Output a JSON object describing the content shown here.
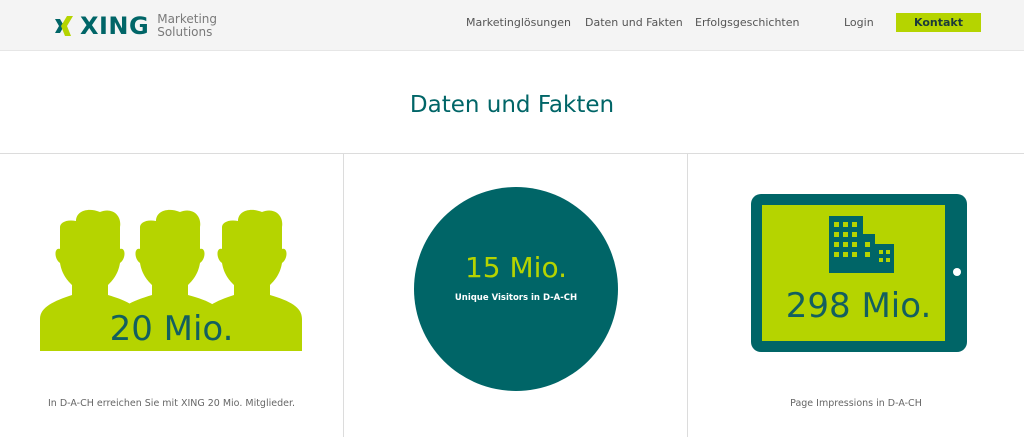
{
  "brand": {
    "name": "XING",
    "sub_line1": "Marketing",
    "sub_line2": "Solutions"
  },
  "nav": [
    {
      "label": "Marketinglösungen"
    },
    {
      "label": "Daten und Fakten"
    },
    {
      "label": "Erfolgsgeschichten"
    }
  ],
  "login_label": "Login",
  "contact_label": "Kontakt",
  "page_title": "Daten und Fakten",
  "facts": [
    {
      "value": "20 Mio.",
      "caption": "In D-A-CH erreichen Sie mit XING 20 Mio. Mitglieder."
    },
    {
      "value": "15 Mio.",
      "caption": "Unique Visitors in D-A-CH"
    },
    {
      "value": "298 Mio.",
      "caption": "Page Impressions in D-A-CH"
    }
  ],
  "icons": [
    "xing-logo-icon",
    "people-icon",
    "tablet-icon",
    "buildings-icon"
  ],
  "colors": {
    "teal": "#006567",
    "lime": "#b5d400",
    "header_bg": "#f4f4f4"
  }
}
